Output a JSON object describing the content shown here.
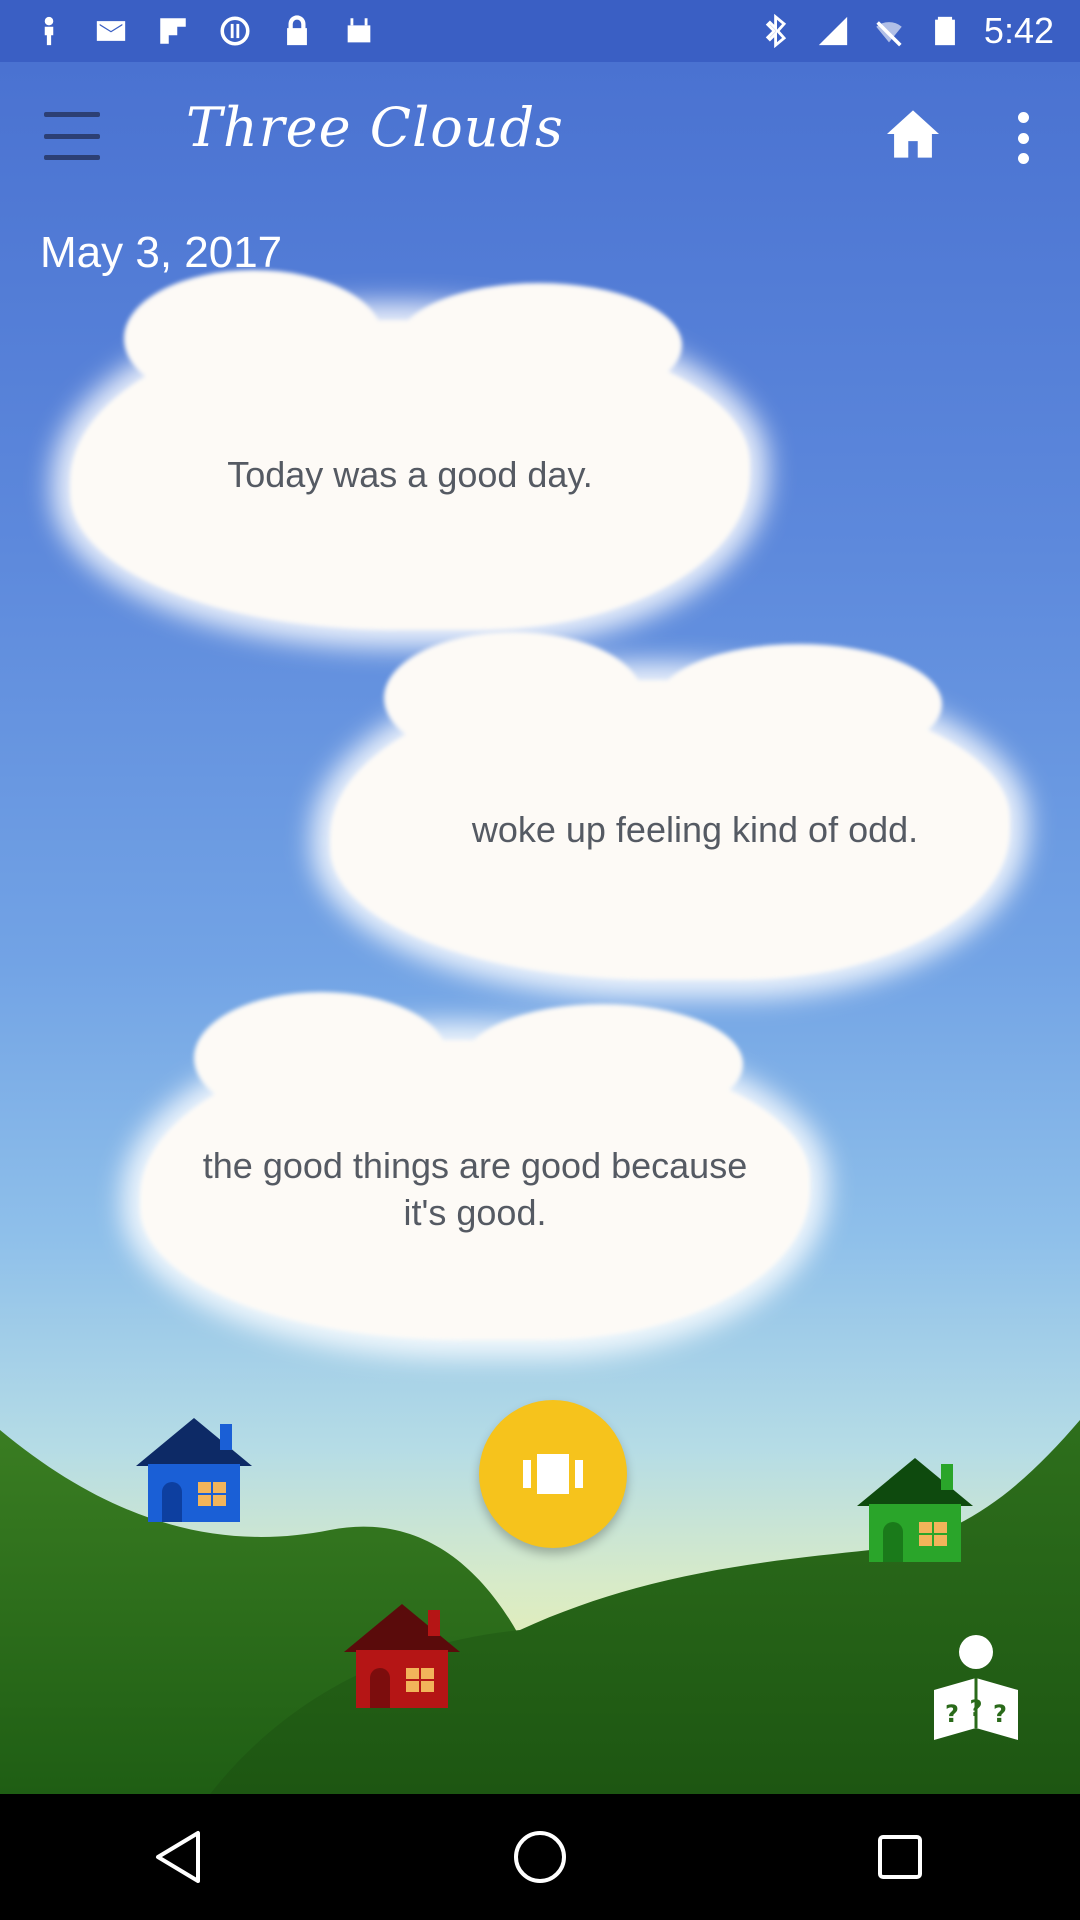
{
  "status_bar": {
    "time": "5:42",
    "left_icons": [
      "person-icon",
      "mail-icon",
      "flipboard-icon",
      "sync-icon",
      "lock-icon",
      "android-icon"
    ],
    "right_icons": [
      "bluetooth-icon",
      "signal-icon",
      "wifi-off-icon",
      "battery-icon"
    ]
  },
  "app_bar": {
    "title": "Three Clouds",
    "menu_icon": "hamburger-menu-icon",
    "home_icon": "home-icon",
    "more_icon": "more-vertical-icon"
  },
  "entry": {
    "date": "May 3, 2017",
    "clouds": [
      {
        "text": "Today was a good day."
      },
      {
        "text": "woke up feeling kind of odd."
      },
      {
        "text": "the good things are good because it's good."
      }
    ]
  },
  "colors": {
    "sky_top": "#4a72d1",
    "fab": "#f6c31c",
    "hill_dark": "#1f5e14",
    "house_blue": "#1a5fd6",
    "house_red": "#b51515",
    "house_green": "#2aa52a"
  },
  "scene": {
    "fab_icon": "gallery-icon",
    "help_icon": "reader-help-icon"
  },
  "nav_bar": {
    "icons": [
      "back-icon",
      "home-circle-icon",
      "recents-icon"
    ]
  }
}
